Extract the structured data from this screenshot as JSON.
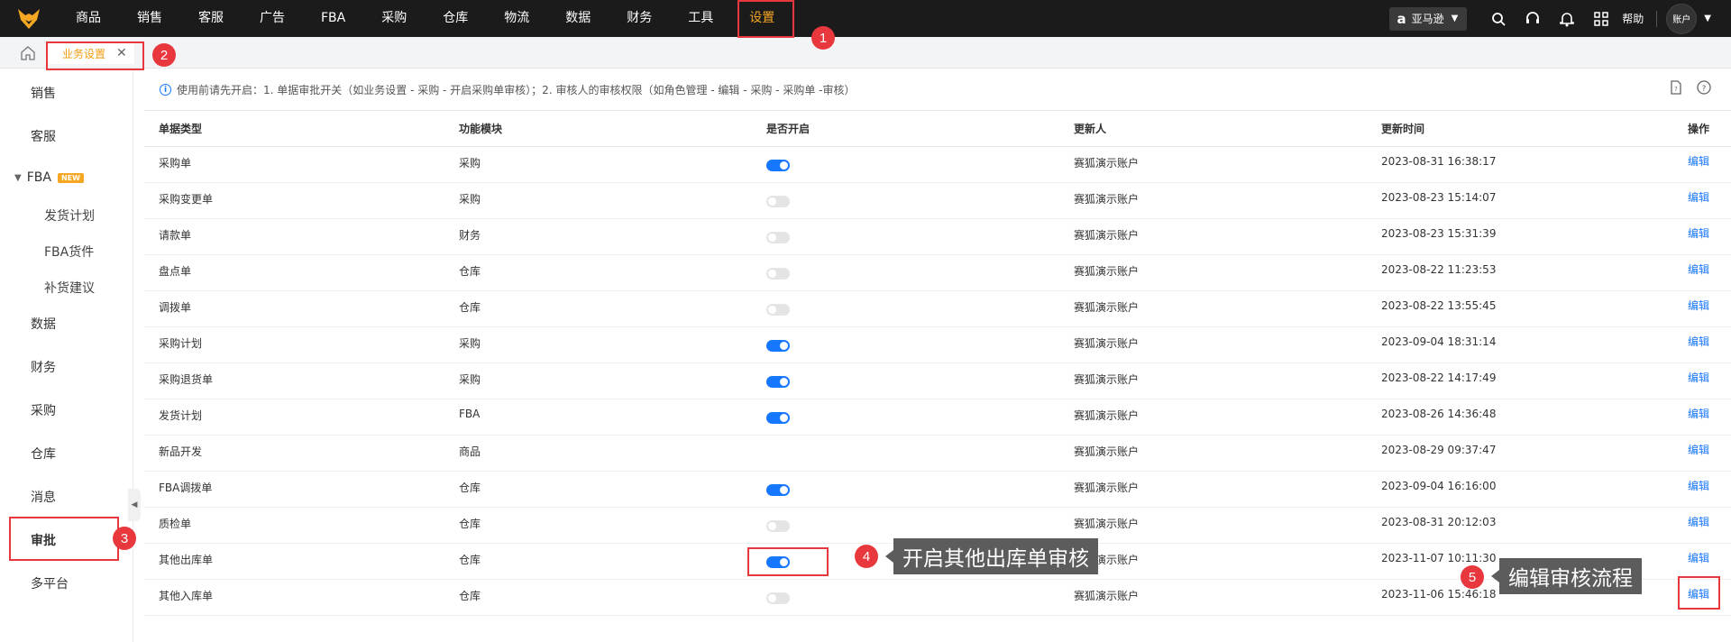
{
  "topnav": {
    "items": [
      "商品",
      "销售",
      "客服",
      "广告",
      "FBA",
      "采购",
      "仓库",
      "物流",
      "数据",
      "财务",
      "工具",
      "设置"
    ],
    "active_index": 11,
    "store_label": "亚马逊",
    "help_label": "帮助",
    "account_label": "账户",
    "accent_color": "#f5a623"
  },
  "tabs": [
    {
      "label": "业务设置",
      "close": "✕"
    }
  ],
  "sidebar": {
    "items_top": [
      "销售",
      "客服"
    ],
    "group": {
      "label": "FBA",
      "badge": "NEW",
      "children": [
        "发货计划",
        "FBA货件",
        "补货建议"
      ]
    },
    "items_bottom": [
      "数据",
      "财务",
      "采购",
      "仓库",
      "消息",
      "审批",
      "多平台"
    ],
    "active_label": "审批"
  },
  "notice": "使用前请先开启：1. 单据审批开关（如业务设置 - 采购 - 开启采购单审核）；2. 审核人的审核权限（如角色管理 - 编辑 - 采购 - 采购单 -审核）",
  "table": {
    "columns": [
      "单据类型",
      "功能模块",
      "是否开启",
      "更新人",
      "更新时间",
      "操作"
    ],
    "edit_label": "编辑",
    "rows": [
      {
        "type": "采购单",
        "module": "采购",
        "enabled": true,
        "user": "赛狐演示账户",
        "time": "2023-08-31 16:38:17"
      },
      {
        "type": "采购变更单",
        "module": "采购",
        "enabled": false,
        "user": "赛狐演示账户",
        "time": "2023-08-23 15:14:07"
      },
      {
        "type": "请款单",
        "module": "财务",
        "enabled": false,
        "user": "赛狐演示账户",
        "time": "2023-08-23 15:31:39"
      },
      {
        "type": "盘点单",
        "module": "仓库",
        "enabled": false,
        "user": "赛狐演示账户",
        "time": "2023-08-22 11:23:53"
      },
      {
        "type": "调拨单",
        "module": "仓库",
        "enabled": false,
        "user": "赛狐演示账户",
        "time": "2023-08-22 13:55:45"
      },
      {
        "type": "采购计划",
        "module": "采购",
        "enabled": true,
        "user": "赛狐演示账户",
        "time": "2023-09-04 18:31:14"
      },
      {
        "type": "采购退货单",
        "module": "采购",
        "enabled": true,
        "user": "赛狐演示账户",
        "time": "2023-08-22 14:17:49"
      },
      {
        "type": "发货计划",
        "module": "FBA",
        "enabled": true,
        "user": "赛狐演示账户",
        "time": "2023-08-26 14:36:48"
      },
      {
        "type": "新品开发",
        "module": "商品",
        "enabled": null,
        "user": "赛狐演示账户",
        "time": "2023-08-29 09:37:47"
      },
      {
        "type": "FBA调拨单",
        "module": "仓库",
        "enabled": true,
        "user": "赛狐演示账户",
        "time": "2023-09-04 16:16:00"
      },
      {
        "type": "质检单",
        "module": "仓库",
        "enabled": false,
        "user": "赛狐演示账户",
        "time": "2023-08-31 20:12:03"
      },
      {
        "type": "其他出库单",
        "module": "仓库",
        "enabled": true,
        "user": "赛狐演示账户",
        "time": "2023-11-07 10:11:30"
      },
      {
        "type": "其他入库单",
        "module": "仓库",
        "enabled": false,
        "user": "赛狐演示账户",
        "time": "2023-11-06 15:46:18"
      }
    ]
  },
  "annotations": {
    "step1": "1",
    "step2": "2",
    "step3": "3",
    "step4": "4",
    "step4_text": "开启其他出库单审核",
    "step5": "5",
    "step5_text": "编辑审核流程",
    "highlight_color": "#e8383d"
  }
}
